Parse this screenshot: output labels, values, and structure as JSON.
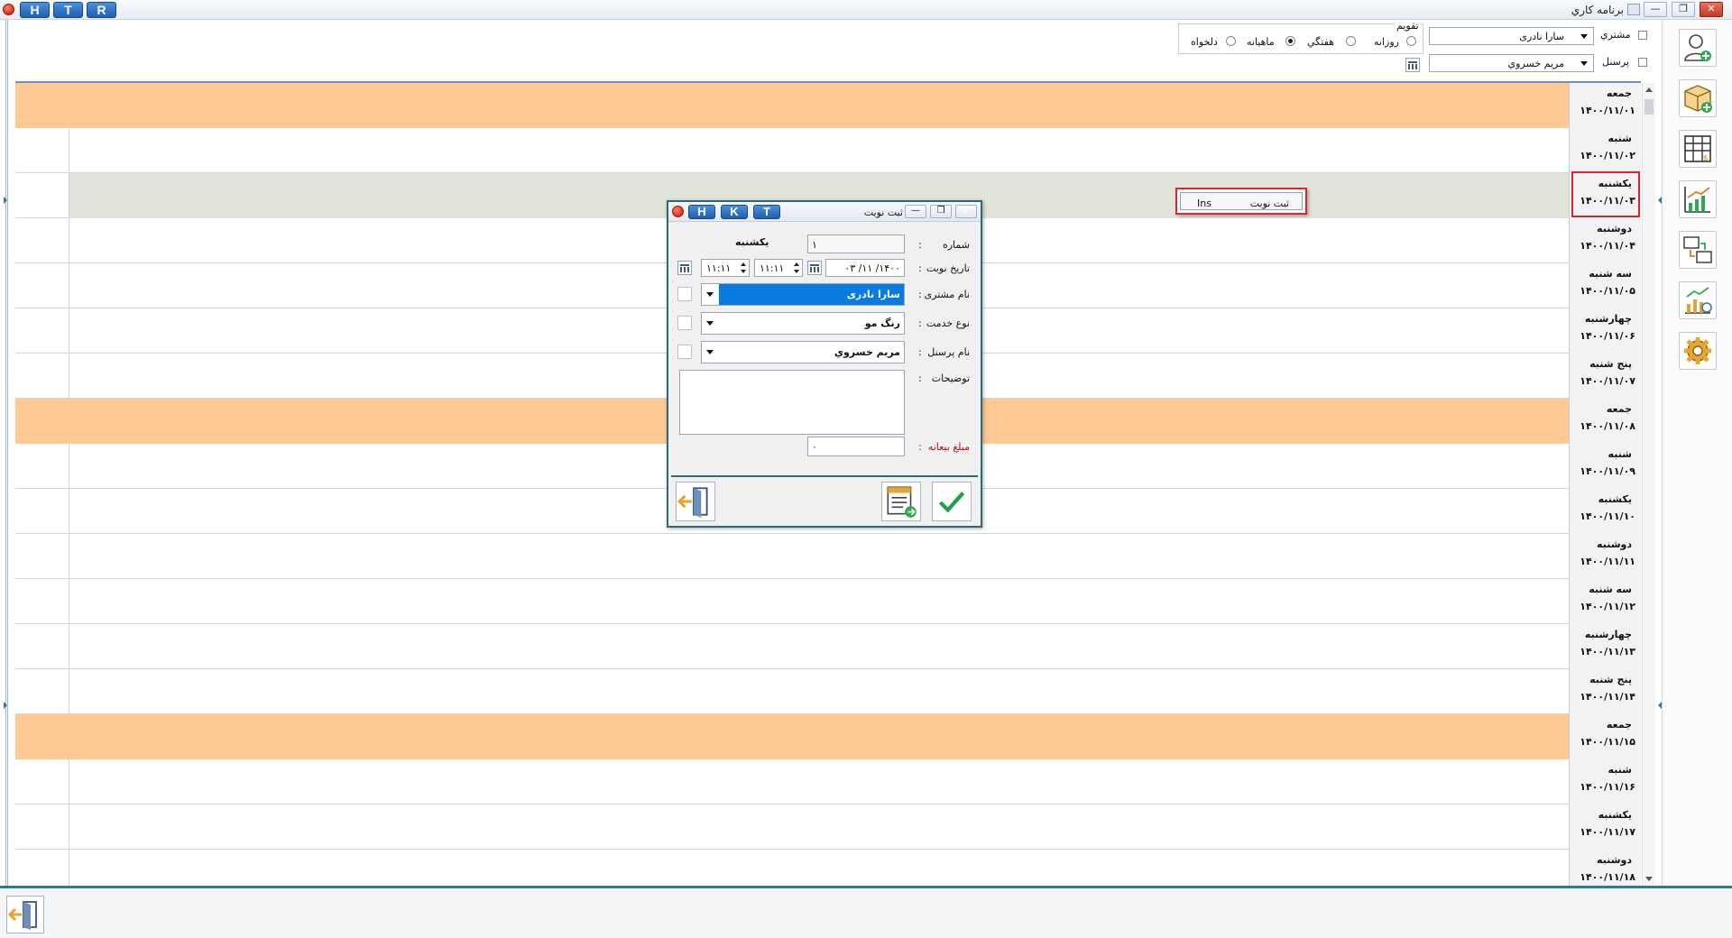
{
  "window": {
    "title": "برنامه کاري",
    "hotkeys": [
      "H",
      "T",
      "R"
    ],
    "controls": [
      "—",
      "❐",
      "✕"
    ]
  },
  "filters": {
    "customer_label": "مشتري",
    "customer_value": "سارا نادری",
    "staff_label": "پرسنل",
    "staff_value": "مريم خسروي",
    "calendar_label": "تقويم",
    "modes": [
      {
        "label": "روزانه",
        "selected": false
      },
      {
        "label": "هفتگي",
        "selected": false
      },
      {
        "label": "ماهيانه",
        "selected": true
      },
      {
        "label": "دلخواه",
        "selected": false
      }
    ]
  },
  "days": [
    {
      "name": "جمعه",
      "date": "۱۴۰۰/۱۱/۰۱",
      "friday": true
    },
    {
      "name": "شنبه",
      "date": "۱۴۰۰/۱۱/۰۲"
    },
    {
      "name": "يکشنبه",
      "date": "۱۴۰۰/۱۱/۰۳",
      "selected": true
    },
    {
      "name": "دوشنبه",
      "date": "۱۴۰۰/۱۱/۰۴"
    },
    {
      "name": "سه شنبه",
      "date": "۱۴۰۰/۱۱/۰۵"
    },
    {
      "name": "چهارشنبه",
      "date": "۱۴۰۰/۱۱/۰۶"
    },
    {
      "name": "پنج شنبه",
      "date": "۱۴۰۰/۱۱/۰۷"
    },
    {
      "name": "جمعه",
      "date": "۱۴۰۰/۱۱/۰۸",
      "friday": true
    },
    {
      "name": "شنبه",
      "date": "۱۴۰۰/۱۱/۰۹"
    },
    {
      "name": "يکشنبه",
      "date": "۱۴۰۰/۱۱/۱۰"
    },
    {
      "name": "دوشنبه",
      "date": "۱۴۰۰/۱۱/۱۱"
    },
    {
      "name": "سه شنبه",
      "date": "۱۴۰۰/۱۱/۱۲"
    },
    {
      "name": "چهارشنبه",
      "date": "۱۴۰۰/۱۱/۱۳"
    },
    {
      "name": "پنج شنبه",
      "date": "۱۴۰۰/۱۱/۱۴"
    },
    {
      "name": "جمعه",
      "date": "۱۴۰۰/۱۱/۱۵",
      "friday": true
    },
    {
      "name": "شنبه",
      "date": "۱۴۰۰/۱۱/۱۶"
    },
    {
      "name": "يکشنبه",
      "date": "۱۴۰۰/۱۱/۱۷"
    },
    {
      "name": "دوشنبه",
      "date": "۱۴۰۰/۱۱/۱۸"
    }
  ],
  "context_menu": {
    "label": "ثبت نوبت",
    "shortcut": "Ins"
  },
  "dialog": {
    "title": "ثبت نوبت",
    "hotkeys": [
      "H",
      "K",
      "T"
    ],
    "number_label": "شماره",
    "number_value": "۱",
    "weekday": "يکشنبه",
    "date_label": "تاريخ نوبت",
    "date_value": "۱۴۰۰/ ۱۱/ ۰۳",
    "time_from": "۱۱:۱۱",
    "time_to": "۱۱:۱۱",
    "customer_label": "نام مشتری",
    "customer_value": "سارا نادری",
    "service_label": "نوع خدمت",
    "service_value": "رنگ مو",
    "staff_label": "نام پرسنل",
    "staff_value": "مريم خسروي",
    "notes_label": "توضيحات",
    "deposit_label": "مبلغ بيعانه",
    "deposit_value": "۰",
    "colon": ":"
  },
  "right_toolbar": [
    "add-customer",
    "add-package",
    "price-table",
    "report-chart",
    "transfer",
    "analytics",
    "settings"
  ]
}
